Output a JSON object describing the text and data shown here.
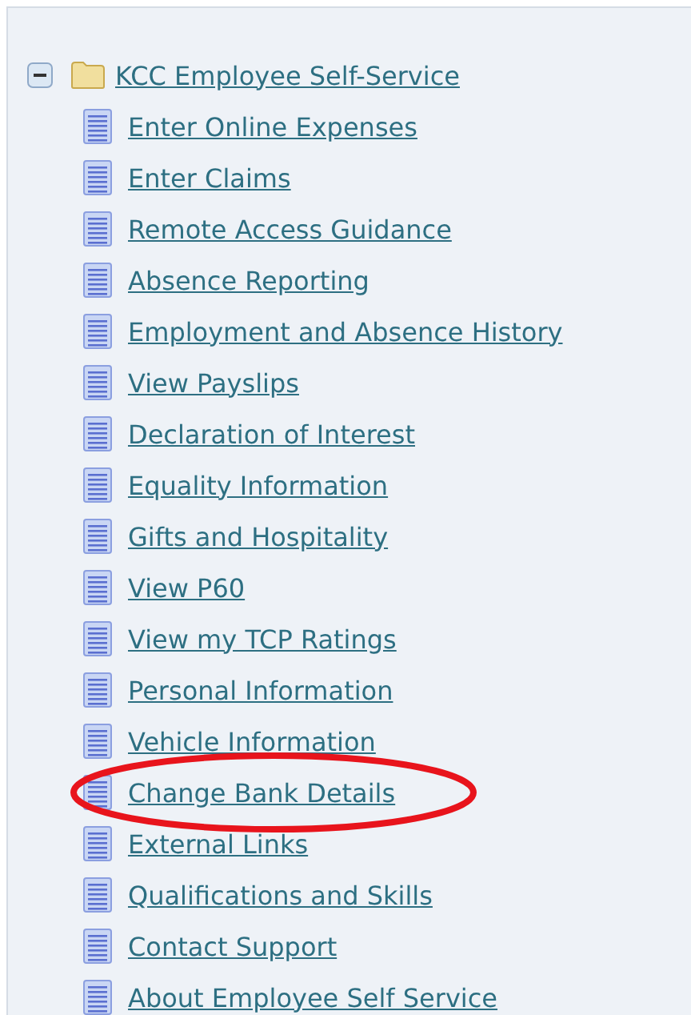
{
  "tree": {
    "label": "KCC Employee Self-Service",
    "expanded": true,
    "children": [
      {
        "label": "Enter Online Expenses",
        "highlighted": false
      },
      {
        "label": "Enter Claims",
        "highlighted": false
      },
      {
        "label": "Remote Access Guidance",
        "highlighted": false
      },
      {
        "label": "Absence Reporting",
        "highlighted": false
      },
      {
        "label": "Employment and Absence History",
        "highlighted": false
      },
      {
        "label": "View Payslips",
        "highlighted": false
      },
      {
        "label": "Declaration of Interest",
        "highlighted": false
      },
      {
        "label": "Equality Information",
        "highlighted": false
      },
      {
        "label": "Gifts and Hospitality",
        "highlighted": false
      },
      {
        "label": "View P60",
        "highlighted": false
      },
      {
        "label": "View my TCP Ratings",
        "highlighted": false
      },
      {
        "label": "Personal Information",
        "highlighted": false
      },
      {
        "label": "Vehicle Information",
        "highlighted": false
      },
      {
        "label": "Change Bank Details",
        "highlighted": true
      },
      {
        "label": "External Links",
        "highlighted": false
      },
      {
        "label": "Qualifications and Skills",
        "highlighted": false
      },
      {
        "label": "Contact Support",
        "highlighted": false
      },
      {
        "label": "About Employee Self Service",
        "highlighted": false
      }
    ]
  }
}
